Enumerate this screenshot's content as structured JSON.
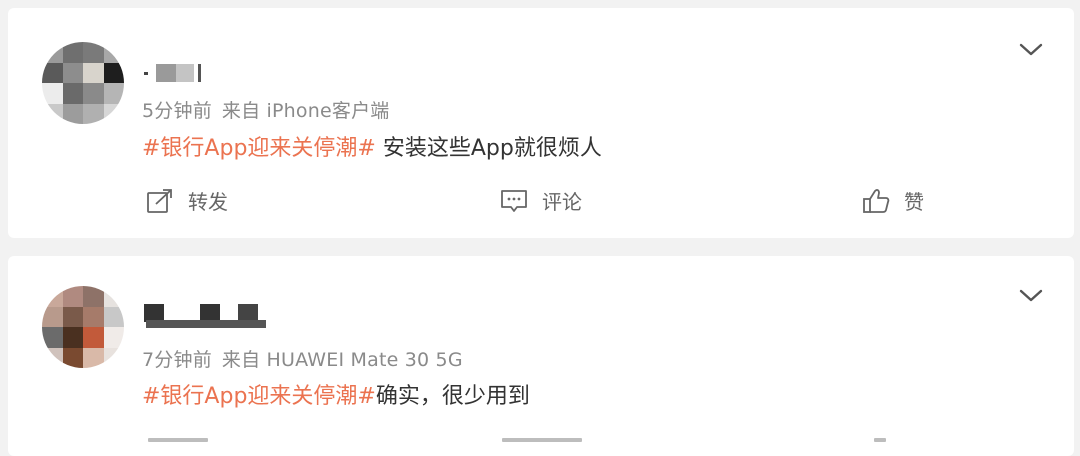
{
  "posts": [
    {
      "time": "5分钟前",
      "source": "来自 iPhone客户端",
      "topic": "#银行App迎来关停潮#",
      "text": " 安装这些App就很烦人",
      "actions": {
        "repost": "转发",
        "comment": "评论",
        "like": "赞"
      }
    },
    {
      "time": "7分钟前",
      "source": "来自 HUAWEI Mate 30 5G",
      "topic": "#银行App迎来关停潮#",
      "text": "确实，很少用到"
    }
  ],
  "colors": {
    "topic": "#eb7350",
    "meta": "#8a8a8a",
    "text": "#333333",
    "background": "#f2f2f2"
  },
  "icons": [
    "chevron-down-icon",
    "repost-icon",
    "comment-icon",
    "like-icon"
  ]
}
